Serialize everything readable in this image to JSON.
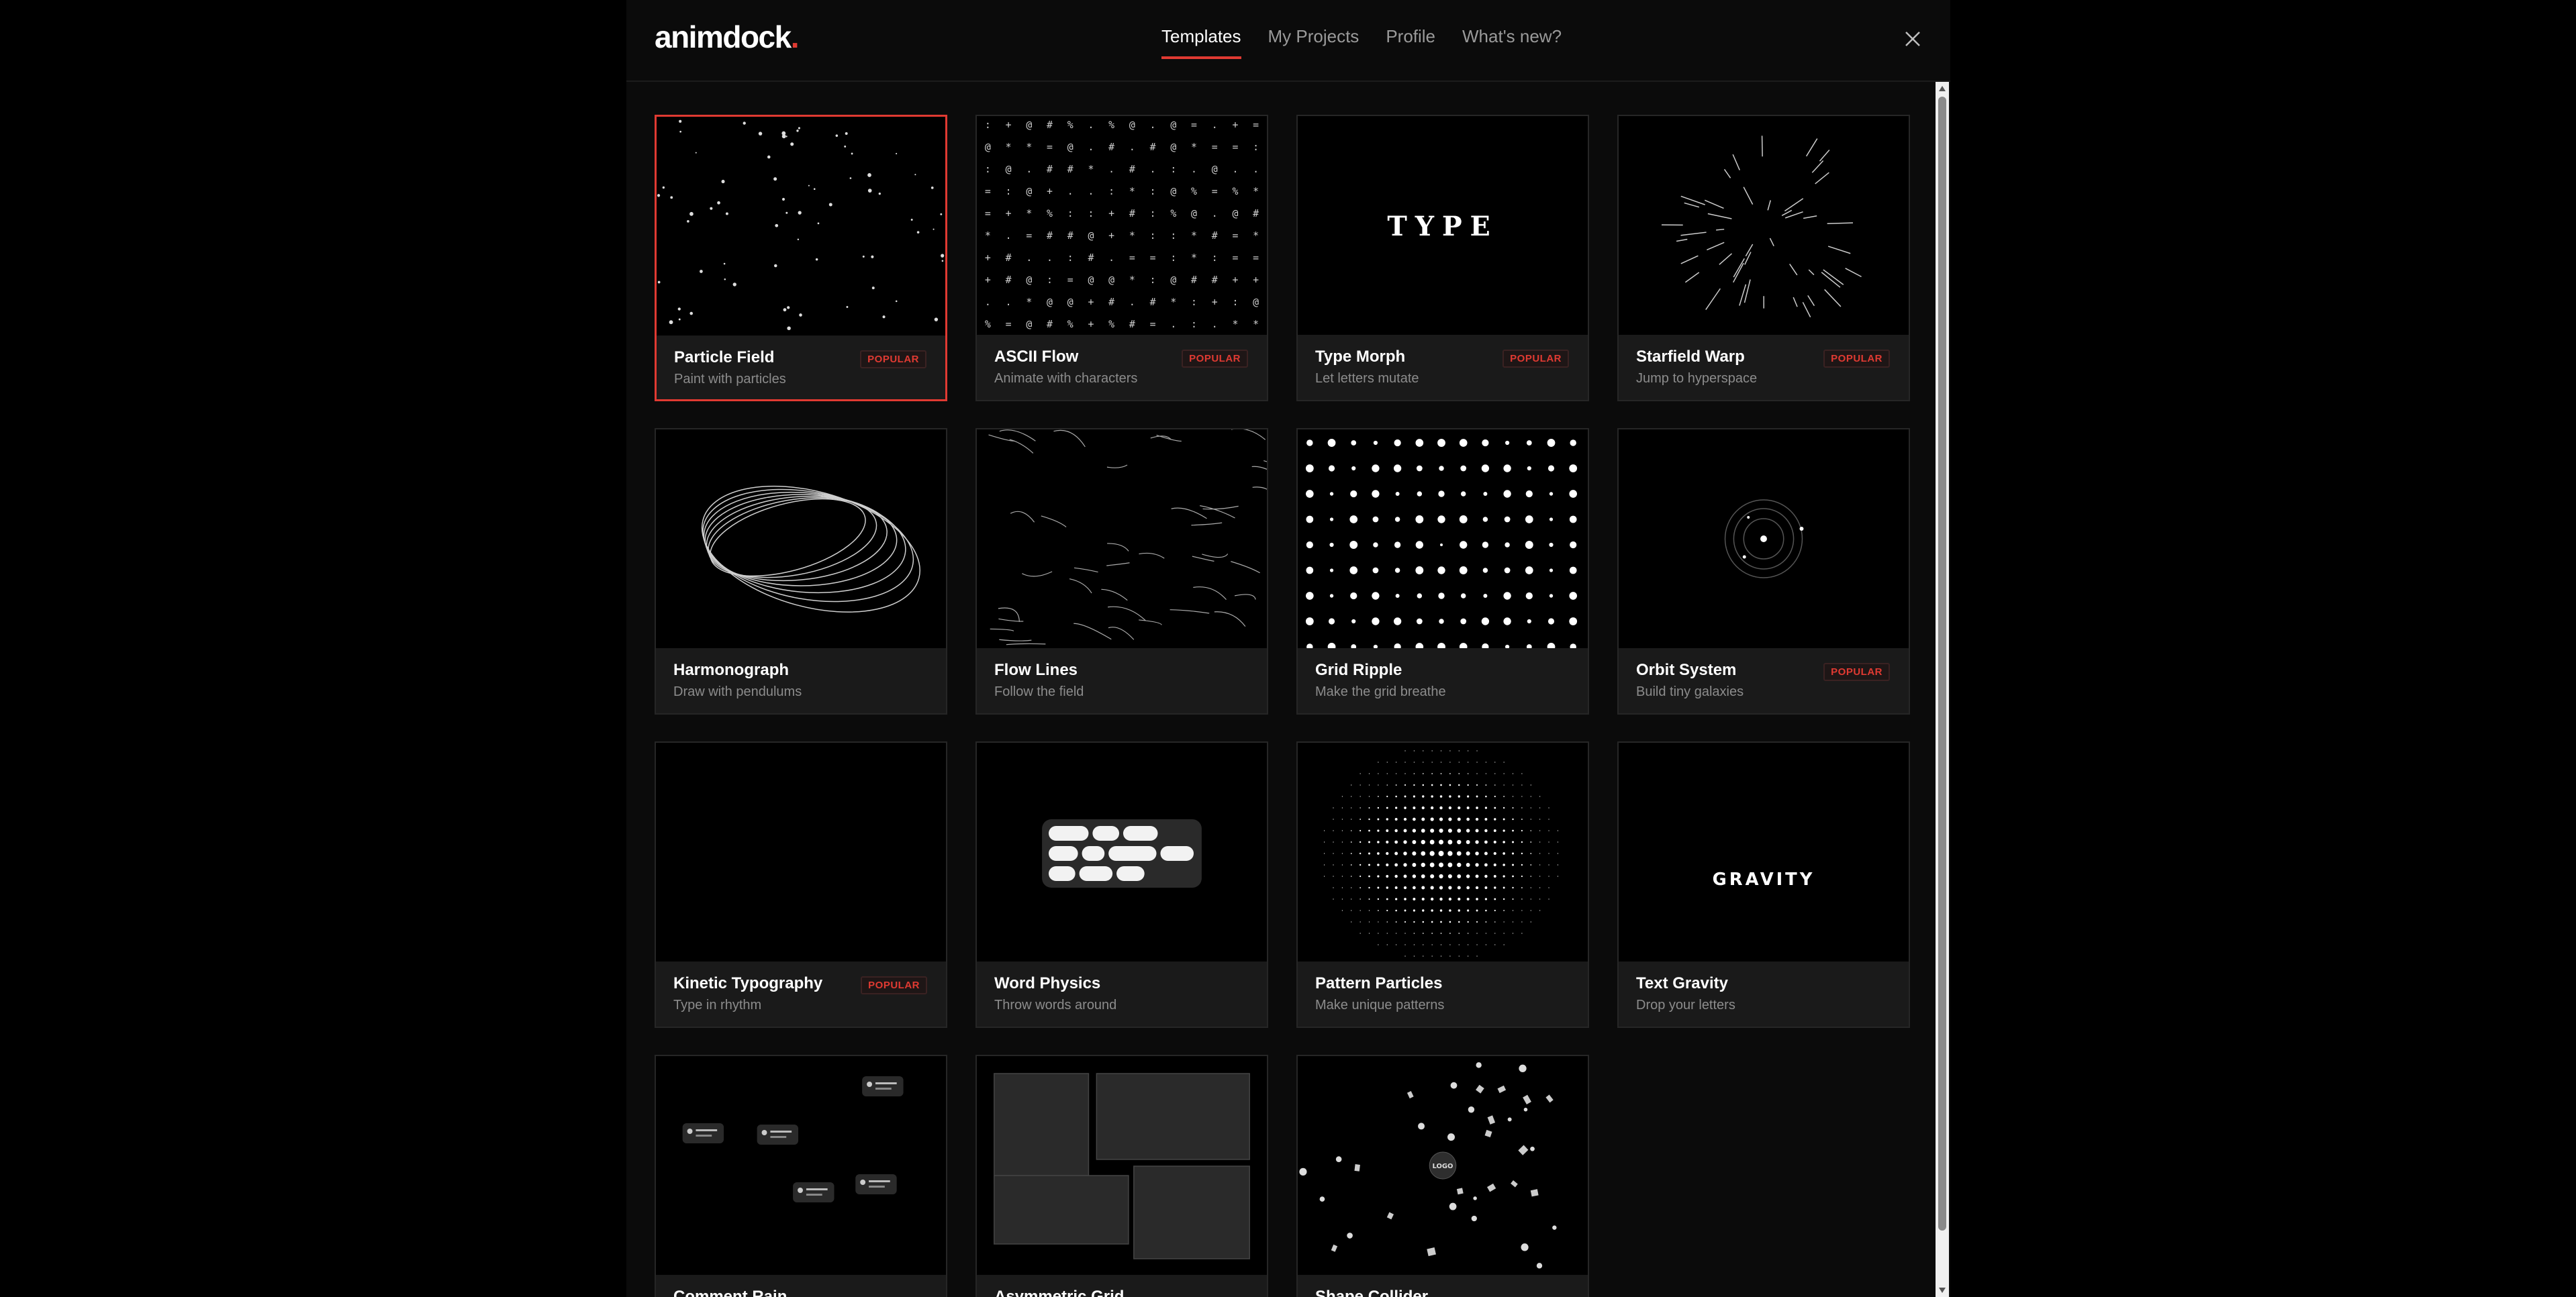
{
  "header": {
    "logo_text": "animdock",
    "logo_dot": ".",
    "tabs": [
      {
        "label": "Templates",
        "active": true
      },
      {
        "label": "My Projects",
        "active": false
      },
      {
        "label": "Profile",
        "active": false
      },
      {
        "label": "What's new?",
        "active": false
      }
    ],
    "close_icon": "close-icon"
  },
  "colors": {
    "accent": "#e03a32",
    "background": "#0b0b0b",
    "card": "#1a1a1a"
  },
  "badge_label": "POPULAR",
  "templates": [
    {
      "name": "Particle Field",
      "desc": "Paint with particles",
      "popular": true,
      "selected": true,
      "preview": "particle-field-preview"
    },
    {
      "name": "ASCII Flow",
      "desc": "Animate with characters",
      "popular": true,
      "selected": false,
      "preview": "ascii-flow-preview"
    },
    {
      "name": "Type Morph",
      "desc": "Let letters mutate",
      "popular": true,
      "selected": false,
      "preview": "type-morph-preview",
      "preview_text": "TYPE"
    },
    {
      "name": "Starfield Warp",
      "desc": "Jump to hyperspace",
      "popular": true,
      "selected": false,
      "preview": "starfield-warp-preview"
    },
    {
      "name": "Harmonograph",
      "desc": "Draw with pendulums",
      "popular": false,
      "selected": false,
      "preview": "harmonograph-preview"
    },
    {
      "name": "Flow Lines",
      "desc": "Follow the field",
      "popular": false,
      "selected": false,
      "preview": "flow-lines-preview"
    },
    {
      "name": "Grid Ripple",
      "desc": "Make the grid breathe",
      "popular": false,
      "selected": false,
      "preview": "grid-ripple-preview"
    },
    {
      "name": "Orbit System",
      "desc": "Build tiny galaxies",
      "popular": true,
      "selected": false,
      "preview": "orbit-system-preview"
    },
    {
      "name": "Kinetic Typography",
      "desc": "Type in rhythm",
      "popular": true,
      "selected": false,
      "preview": "kinetic-typography-preview"
    },
    {
      "name": "Word Physics",
      "desc": "Throw words around",
      "popular": false,
      "selected": false,
      "preview": "word-physics-preview"
    },
    {
      "name": "Pattern Particles",
      "desc": "Make unique patterns",
      "popular": false,
      "selected": false,
      "preview": "pattern-particles-preview"
    },
    {
      "name": "Text Gravity",
      "desc": "Drop your letters",
      "popular": false,
      "selected": false,
      "preview": "text-gravity-preview",
      "preview_text": "GRAVITY"
    },
    {
      "name": "Comment Rain",
      "desc": "",
      "popular": false,
      "selected": false,
      "preview": "comment-rain-preview"
    },
    {
      "name": "Asymmetric Grid",
      "desc": "",
      "popular": false,
      "selected": false,
      "preview": "asymmetric-grid-preview"
    },
    {
      "name": "Shape Collider",
      "desc": "",
      "popular": false,
      "selected": false,
      "preview": "shape-collider-preview",
      "preview_text": "LOGO"
    }
  ]
}
